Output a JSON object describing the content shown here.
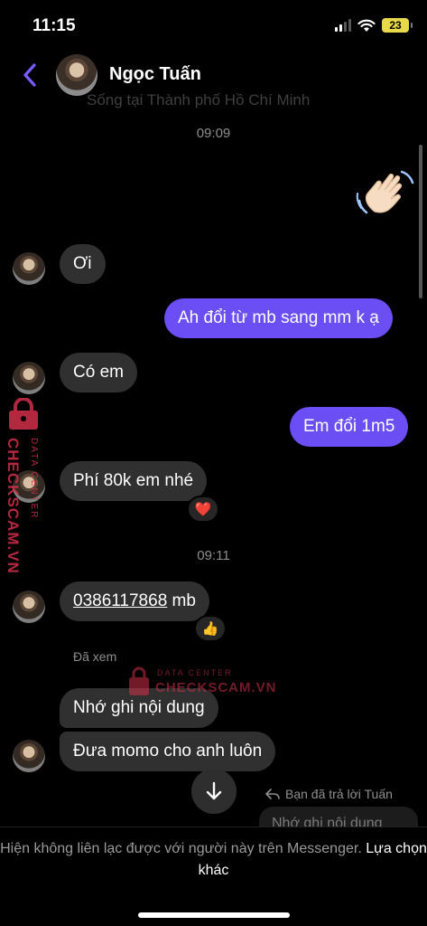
{
  "status_bar": {
    "time": "11:15",
    "battery": "23"
  },
  "header": {
    "contact_name": "Ngọc Tuấn",
    "subtitle": "Sống tại Thành phố Hồ Chí Minh"
  },
  "messages": {
    "time_1": "09:09",
    "wave_emoji": "👋",
    "in_1": "Ơi",
    "out_1": "Ah đổi từ mb sang mm k ạ",
    "in_2": "Có em",
    "out_2": "Em đổi 1m5",
    "in_3": "Phí 80k em nhé",
    "reaction_1": "❤️",
    "time_2": "09:11",
    "in_4_phone": "0386117868",
    "in_4_suffix": " mb",
    "reaction_2": "👍",
    "seen": "Đã xem",
    "in_5": "Nhớ ghi nội dung",
    "in_6": "Đưa momo cho anh luôn",
    "replied_label": "Bạn đã trả lời Tuấn",
    "reply_preview": "Nhớ ghi nội dung"
  },
  "watermark": {
    "small": "DATA CENTER",
    "big": "CHECKSCAM.VN"
  },
  "footer": {
    "notice": "Hiện không liên lạc được với người này trên Messenger.",
    "action": "Lựa chọn khác"
  },
  "colors": {
    "accent": "#6b4ef4",
    "incoming": "#303030",
    "watermark": "#d1304a"
  },
  "icons": [
    "back-chevron-icon",
    "signal-icon",
    "wifi-icon",
    "battery-icon",
    "reply-arrow-icon",
    "arrow-down-icon",
    "lock-icon"
  ]
}
